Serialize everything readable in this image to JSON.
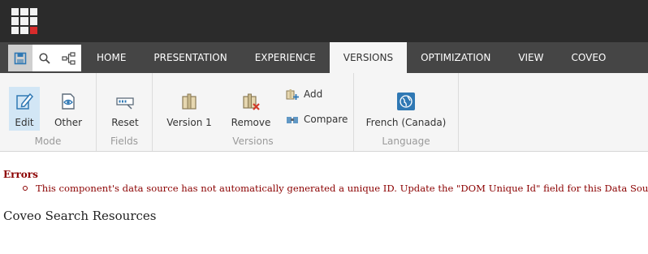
{
  "launchpad": {
    "icon": "app-grid-icon",
    "accent_color": "#d72b2b"
  },
  "quick_access": [
    {
      "name": "save",
      "icon": "save-icon"
    },
    {
      "name": "search",
      "icon": "search-icon"
    },
    {
      "name": "navigator",
      "icon": "tree-icon"
    }
  ],
  "tabs": [
    {
      "label": "HOME"
    },
    {
      "label": "PRESENTATION"
    },
    {
      "label": "EXPERIENCE"
    },
    {
      "label": "VERSIONS",
      "active": true
    },
    {
      "label": "OPTIMIZATION"
    },
    {
      "label": "VIEW"
    },
    {
      "label": "COVEO"
    }
  ],
  "ribbon": {
    "mode": {
      "label": "Mode",
      "edit": "Edit",
      "other": "Other"
    },
    "fields": {
      "label": "Fields",
      "reset": "Reset"
    },
    "versions": {
      "label": "Versions",
      "version": "Version 1",
      "remove": "Remove",
      "add": "Add",
      "compare": "Compare"
    },
    "language": {
      "label": "Language",
      "current": "French (Canada)"
    }
  },
  "errors": {
    "title": "Errors",
    "items": [
      "This component's data source has not automatically generated a unique ID. Update the \"DOM Unique Id\" field for this Data Source."
    ]
  },
  "page": {
    "heading": "Coveo Search Resources"
  },
  "colors": {
    "error": "#8b0000",
    "topbar": "#2b2b2b",
    "tabbar": "#454545",
    "ribbon": "#f5f5f5",
    "selected": "#d2e6f5"
  }
}
